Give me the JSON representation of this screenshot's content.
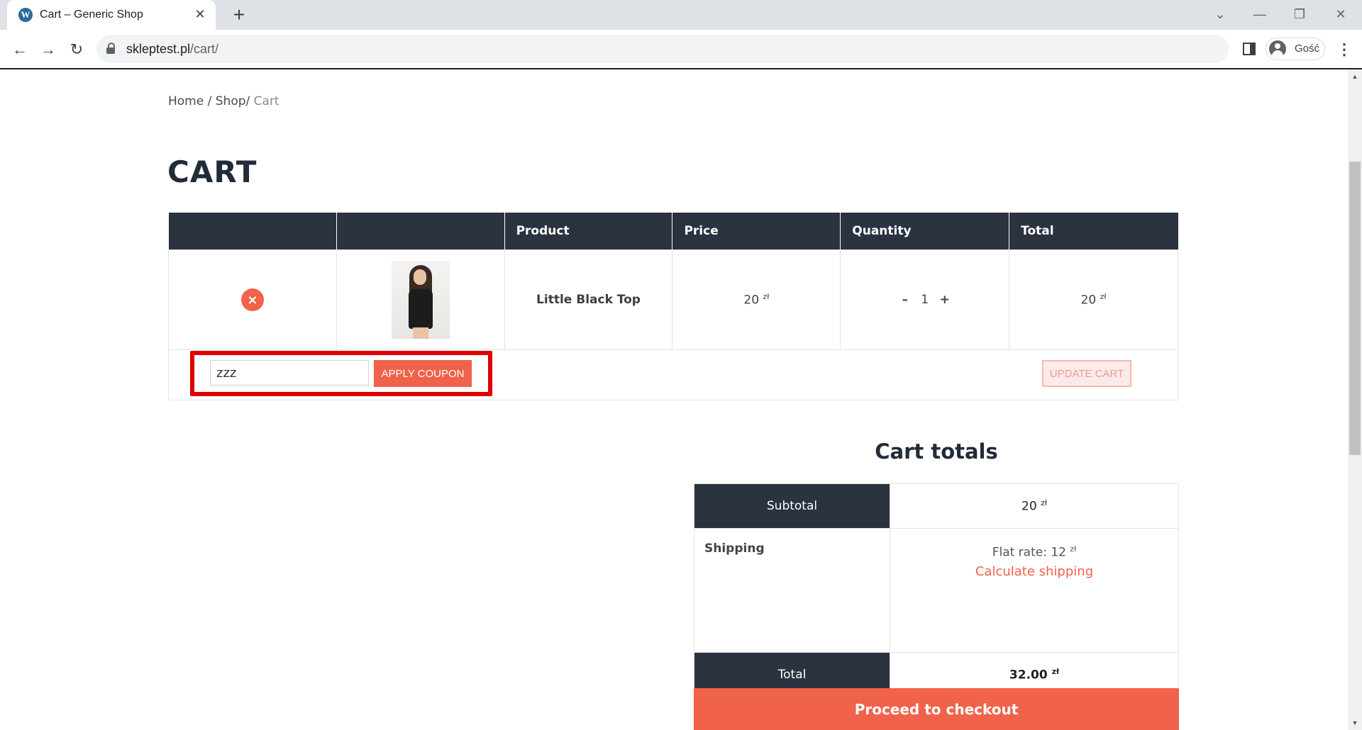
{
  "browser": {
    "tab_title": "Cart – Generic Shop",
    "url_host": "skleptest.pl",
    "url_path": "/cart/",
    "profile_name": "Gość"
  },
  "breadcrumb": {
    "home": "Home",
    "sep1": "/",
    "shop": "Shop",
    "sep2": "/",
    "current": "Cart"
  },
  "page_title": "CART",
  "cart_table": {
    "headers": [
      "",
      "",
      "Product",
      "Price",
      "Quantity",
      "Total"
    ],
    "rows": [
      {
        "product": "Little Black Top",
        "price": "20",
        "currency": "zł",
        "quantity": "1",
        "total": "20"
      }
    ]
  },
  "coupon": {
    "value": "zzz",
    "apply_label": "APPLY COUPON"
  },
  "update_cart_label": "UPDATE CART",
  "cart_totals": {
    "title": "Cart totals",
    "subtotal_label": "Subtotal",
    "subtotal_value": "20",
    "shipping_label": "Shipping",
    "shipping_method": "Flat rate: 12",
    "calculate_shipping": "Calculate shipping",
    "total_label": "Total",
    "total_value": "32.00",
    "currency": "zł"
  },
  "checkout_label": "Proceed to checkout",
  "colors": {
    "accent": "#f0624a",
    "dark": "#2b3240",
    "highlight": "#e00000"
  }
}
